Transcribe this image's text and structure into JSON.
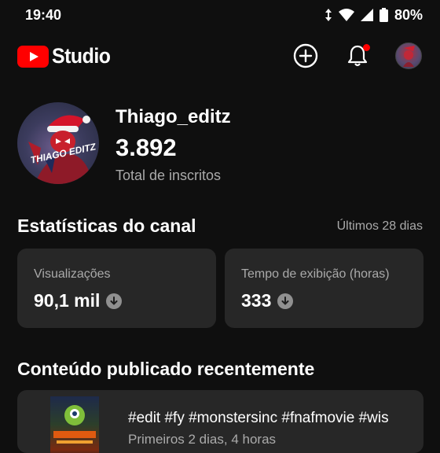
{
  "status_bar": {
    "time": "19:40",
    "battery": "80%"
  },
  "header": {
    "brand_text": "Studio"
  },
  "channel": {
    "name": "Thiago_editz",
    "subscribers": "3.892",
    "subscribers_label": "Total de inscritos",
    "avatar_text": "THIAGO EDITZ"
  },
  "stats": {
    "title": "Estatísticas do canal",
    "period": "Últimos 28 dias",
    "cards": [
      {
        "label": "Visualizações",
        "value": "90,1 mil"
      },
      {
        "label": "Tempo de exibição (horas)",
        "value": "333"
      }
    ]
  },
  "recent": {
    "title": "Conteúdo publicado recentemente",
    "items": [
      {
        "title": "#edit #fy #monstersinc #fnafmovie #wis",
        "meta": "Primeiros 2 dias, 4 horas"
      }
    ]
  },
  "colors": {
    "accent": "#ff0000",
    "background": "#0f0f0f",
    "card": "#272727"
  }
}
